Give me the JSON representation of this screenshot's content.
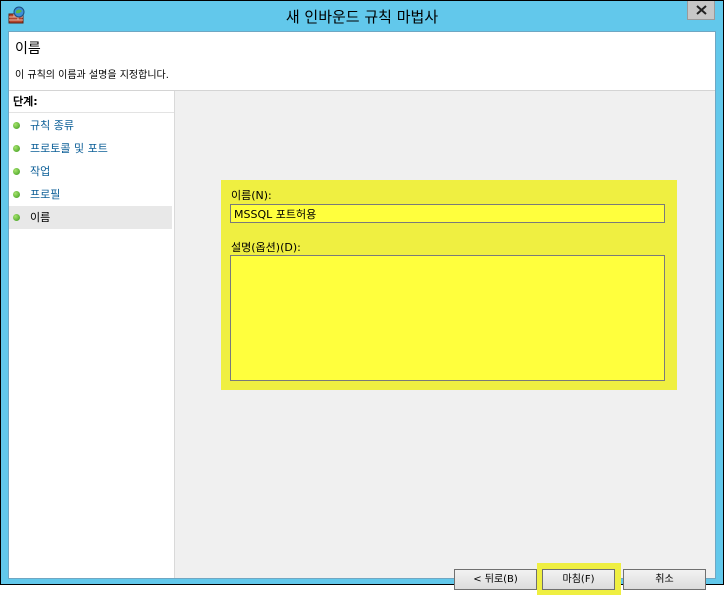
{
  "window": {
    "title": "새 인바운드 규칙 마법사",
    "app_icon": "firewall-wizard-icon",
    "close_icon": "close-icon"
  },
  "header": {
    "title": "이름",
    "description": "이 규칙의 이름과 설명을 지정합니다."
  },
  "steps": {
    "title": "단계:",
    "items": [
      {
        "label": "규칙 종류",
        "active": false
      },
      {
        "label": "프로토콜 및 포트",
        "active": false
      },
      {
        "label": "작업",
        "active": false
      },
      {
        "label": "프로필",
        "active": false
      },
      {
        "label": "이름",
        "active": true
      }
    ]
  },
  "form": {
    "name_label": "이름(N):",
    "name_value": "MSSQL 포트허용",
    "desc_label": "설명(옵션)(D):",
    "desc_value": ""
  },
  "buttons": {
    "back": "< 뒤로(B)",
    "finish": "마침(F)",
    "cancel": "취소"
  },
  "colors": {
    "title_bar": "#62c8eb",
    "highlight": "#efef41",
    "step_dot": "#3a9a1c"
  }
}
